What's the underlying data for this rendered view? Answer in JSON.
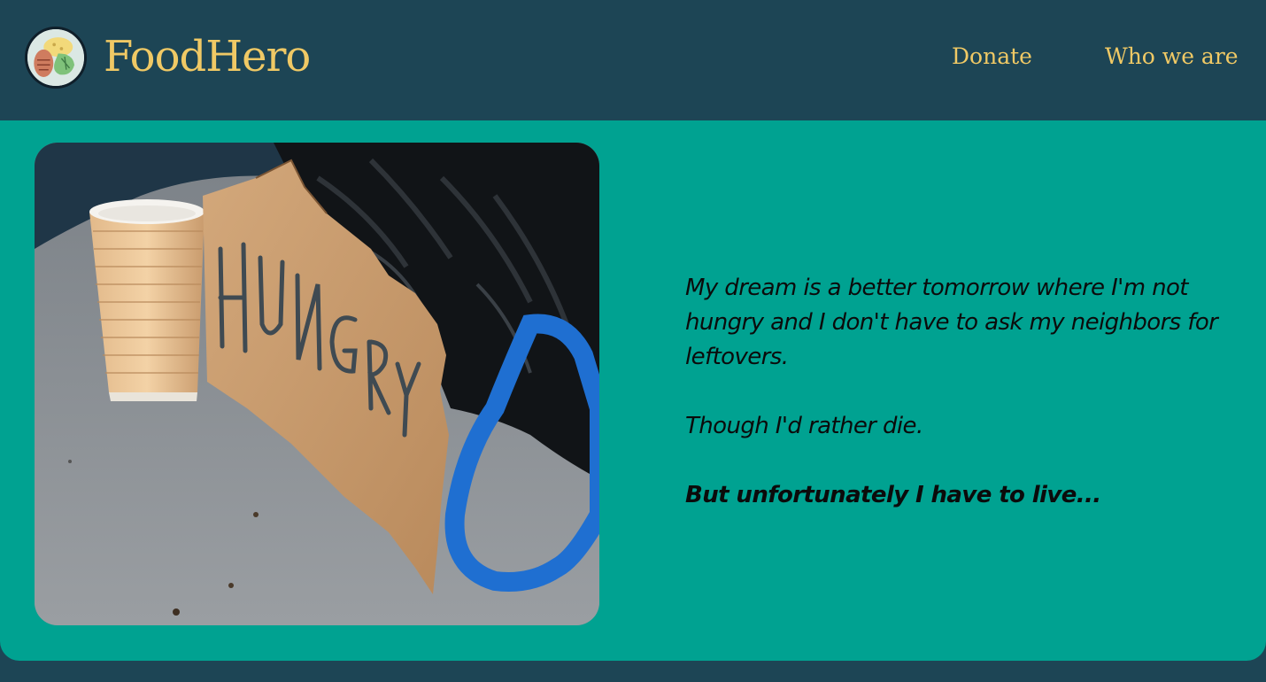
{
  "header": {
    "brand": "FoodHero",
    "logo_icon": "food-bowl-icon",
    "nav": [
      {
        "label": "Donate"
      },
      {
        "label": "Who we are"
      }
    ]
  },
  "hero": {
    "image_subject": "hungry-sign-photo",
    "sign_text": "HUNGRY",
    "quote": [
      "My dream is a better tomorrow where I'm not hungry and I don't have to ask my neighbors for leftovers.",
      "Though I'd rather die.",
      "But unfortunately I have to live..."
    ]
  },
  "colors": {
    "header_bg": "#1d4555",
    "card_bg": "#00a291",
    "accent": "#f0c965",
    "text": "#0b0b0b"
  }
}
